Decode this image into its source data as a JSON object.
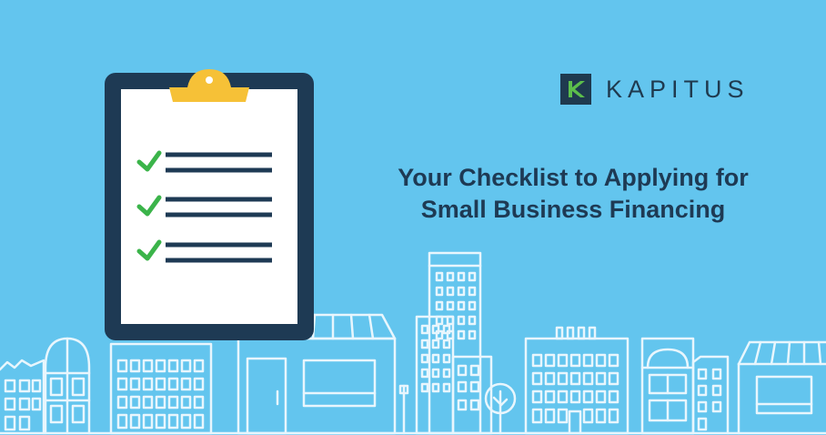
{
  "colors": {
    "sky_blue": "#63c5ee",
    "navy": "#1e3a54",
    "paper": "#ffffff",
    "clip_yellow": "#f6c137",
    "check_green": "#3bb44a",
    "logo_green": "#5cbf4b",
    "line_white": "#e8f6fd"
  },
  "brand": {
    "name": "KAPITUS"
  },
  "headline": {
    "line1": "Your Checklist to Applying for",
    "line2": "Small Business Financing"
  },
  "checklist": {
    "item_count": 3,
    "checked_count": 3
  },
  "icons": [
    "kapitus-logo-icon",
    "clipboard-icon",
    "checkmark-icon",
    "city-skyline-illustration"
  ]
}
